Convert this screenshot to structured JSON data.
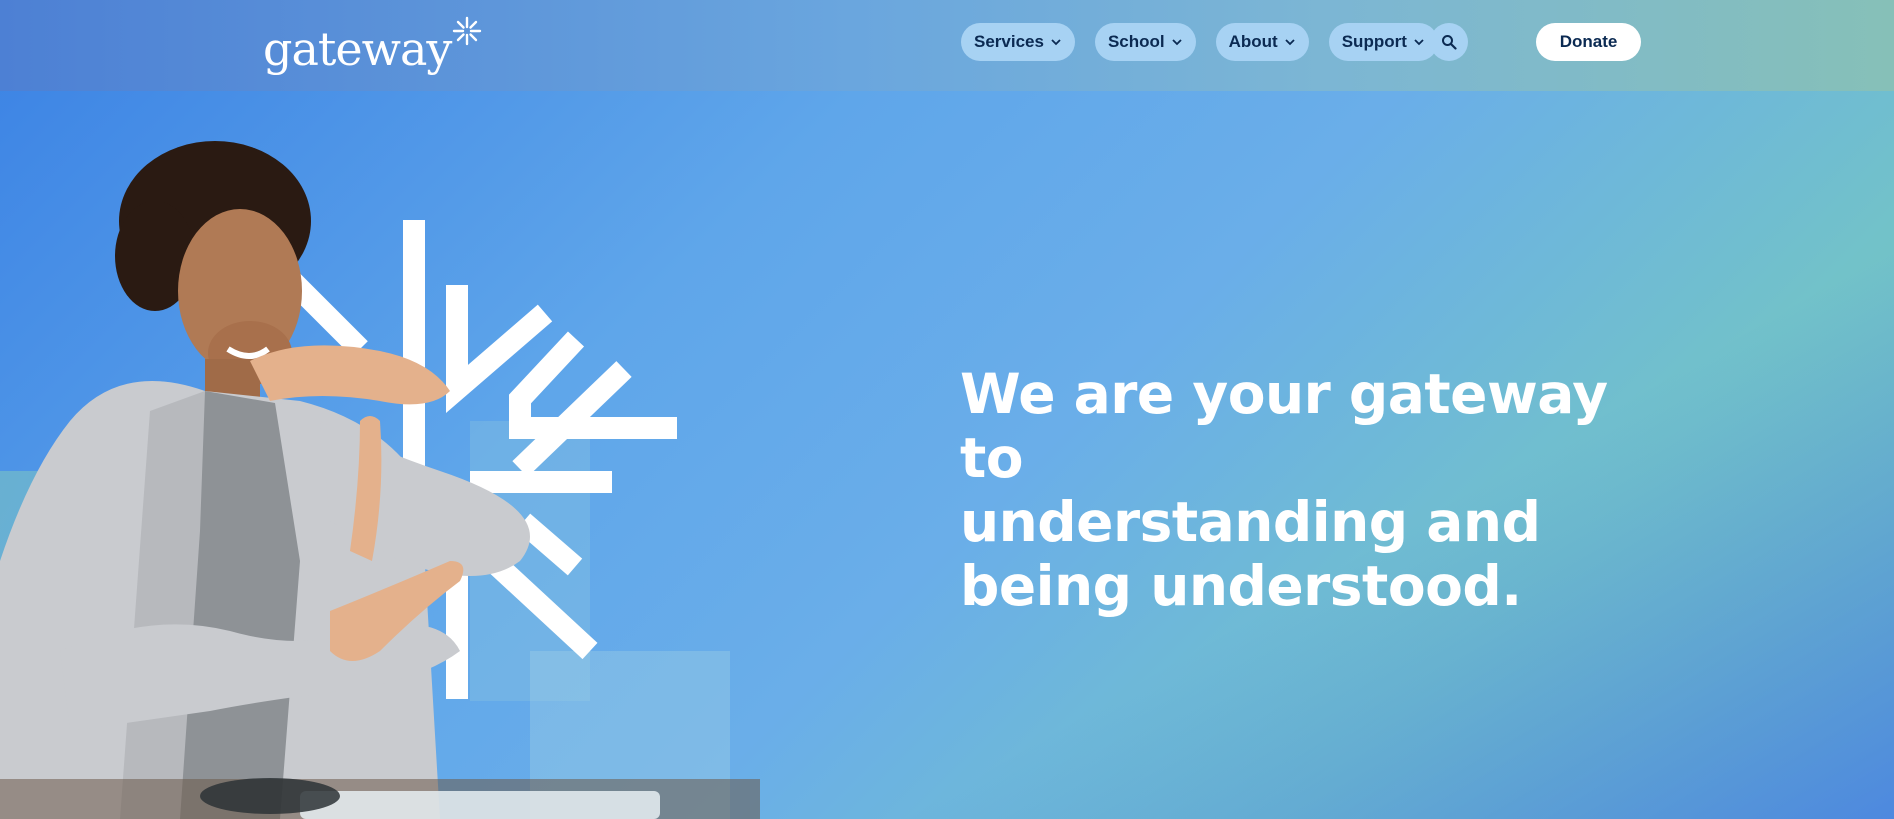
{
  "brand": {
    "logo_text": "gateway",
    "logo_icon": "starburst-icon",
    "colors": {
      "hero_blue": "#3b82e4",
      "hero_teal": "#76c8b8",
      "nav_pill": "#a7d2f3",
      "nav_text": "#0b2a52",
      "white": "#ffffff"
    }
  },
  "nav": {
    "items": [
      {
        "label": "Services",
        "icon": "chevron-down-icon"
      },
      {
        "label": "School",
        "icon": "chevron-down-icon"
      },
      {
        "label": "About",
        "icon": "chevron-down-icon"
      },
      {
        "label": "Support",
        "icon": "chevron-down-icon"
      }
    ],
    "search_icon": "search-icon",
    "donate_label": "Donate"
  },
  "hero": {
    "headline_lines": [
      "We are your gateway to",
      "understanding and",
      "being understood."
    ],
    "image": "woman-signing-photo",
    "graphic": "starburst-arrows-graphic"
  }
}
